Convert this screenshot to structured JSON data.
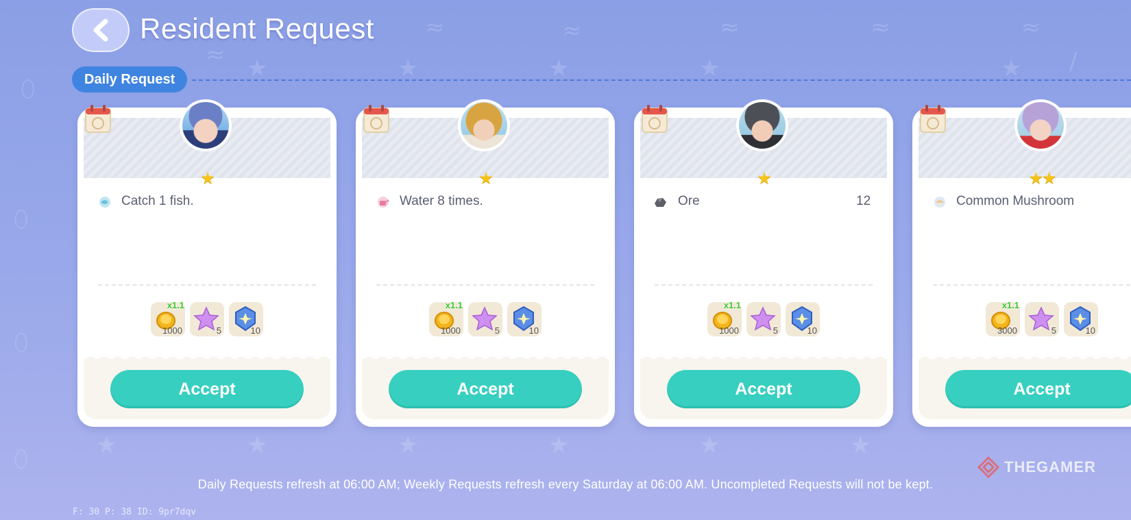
{
  "header": {
    "title": "Resident Request",
    "back_icon": "chevron-left-icon"
  },
  "section": {
    "label": "Daily Request"
  },
  "cards": [
    {
      "resident_avatar": "resident-blue-hat-avatar",
      "stars": "★",
      "task_icon": "fish-icon",
      "task_text": "Catch 1 fish.",
      "task_qty": "",
      "rewards": [
        {
          "icon": "gold-coin-icon",
          "value": "1000",
          "multiplier": "x1.1"
        },
        {
          "icon": "purple-star-icon",
          "value": "5",
          "multiplier": ""
        },
        {
          "icon": "blue-badge-icon",
          "value": "10",
          "multiplier": ""
        }
      ],
      "accept_label": "Accept"
    },
    {
      "resident_avatar": "resident-blonde-avatar",
      "stars": "★",
      "task_icon": "watering-can-icon",
      "task_text": "Water 8 times.",
      "task_qty": "",
      "rewards": [
        {
          "icon": "gold-coin-icon",
          "value": "1000",
          "multiplier": "x1.1"
        },
        {
          "icon": "purple-star-icon",
          "value": "5",
          "multiplier": ""
        },
        {
          "icon": "blue-badge-icon",
          "value": "10",
          "multiplier": ""
        }
      ],
      "accept_label": "Accept"
    },
    {
      "resident_avatar": "resident-goggles-avatar",
      "stars": "★",
      "task_icon": "ore-icon",
      "task_text": "Ore",
      "task_qty": "12",
      "rewards": [
        {
          "icon": "gold-coin-icon",
          "value": "1000",
          "multiplier": "x1.1"
        },
        {
          "icon": "purple-star-icon",
          "value": "5",
          "multiplier": ""
        },
        {
          "icon": "blue-badge-icon",
          "value": "10",
          "multiplier": ""
        }
      ],
      "accept_label": "Accept"
    },
    {
      "resident_avatar": "resident-lavender-hair-avatar",
      "stars": "★★",
      "task_icon": "mushroom-icon",
      "task_text": "Common Mushroom",
      "task_qty": "",
      "rewards": [
        {
          "icon": "gold-coin-icon",
          "value": "3000",
          "multiplier": "x1.1"
        },
        {
          "icon": "purple-star-icon",
          "value": "5",
          "multiplier": ""
        },
        {
          "icon": "blue-badge-icon",
          "value": "10",
          "multiplier": ""
        }
      ],
      "accept_label": "Accept"
    }
  ],
  "footer": {
    "note": "Daily Requests refresh at 06:00 AM; Weekly Requests refresh every Saturday at 06:00 AM. Uncompleted Requests will not be kept.",
    "debug": "F: 30   P: 38   ID: 9pr7dqv"
  },
  "watermark": {
    "text": "THEGAMER"
  },
  "colors": {
    "accent_teal": "#37cfbf",
    "tab_blue": "#3f84e0",
    "star_yellow": "#f6c419",
    "bonus_green": "#3cc42d"
  }
}
